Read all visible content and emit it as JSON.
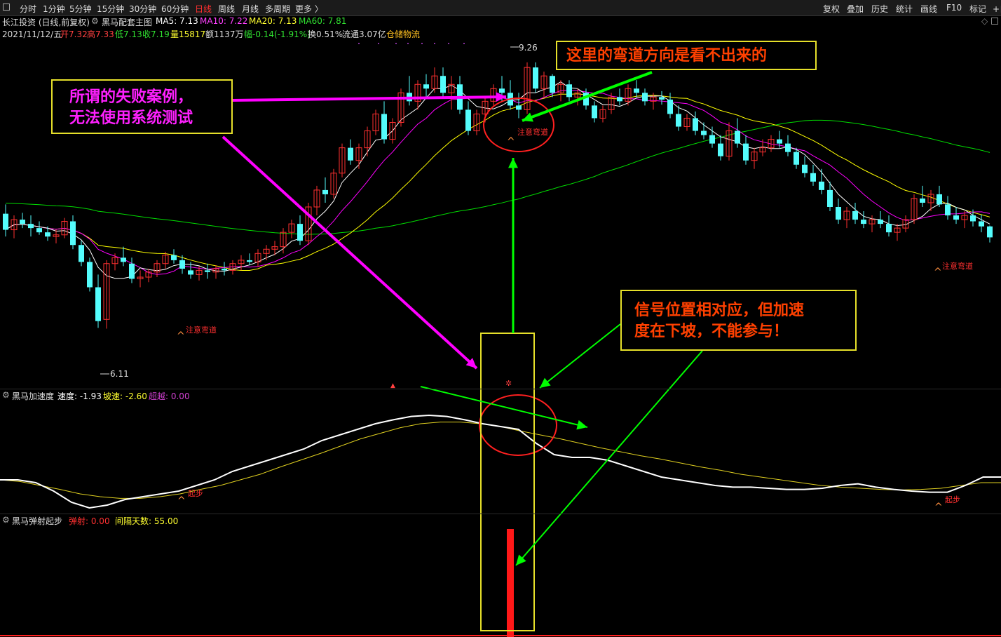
{
  "toolbar": {
    "periods": [
      "分时",
      "1分钟",
      "5分钟",
      "15分钟",
      "30分钟",
      "60分钟",
      "日线",
      "周线",
      "月线",
      "多周期",
      "更多 〉"
    ],
    "active_period": "日线",
    "right_items": [
      "复权",
      "叠加",
      "历史",
      "统计",
      "画线",
      "F10",
      "标记",
      "+自"
    ]
  },
  "header": {
    "stock": "长江投资 (日线,前复权)",
    "indicator": "黑马配套主图",
    "ma5": "MA5: 7.13",
    "ma10": "MA10: 7.22",
    "ma20": "MA20: 7.13",
    "ma60": "MA60: 7.81",
    "date": "2021/11/12/五",
    "open": "开7.32",
    "high": "高7.33",
    "low": "低7.13",
    "close": "收7.19",
    "volume": "量15817",
    "amount": "额1137万",
    "change": "幅-0.14(-1.91%)",
    "turnover": "换0.51%",
    "float": "流通3.07亿",
    "sector": "仓储物流"
  },
  "colors": {
    "up": "#ff3030",
    "down": "#54fcfc",
    "ma5": "#ffffff",
    "ma10": "#ff00ff",
    "ma20": "#ffff00",
    "ma60": "#00dd00",
    "accent": "#ff3030",
    "callout_border": "#e6e02a",
    "magenta_arrow": "#ff00ff",
    "green_arrow": "#00ff00"
  },
  "panel2": {
    "name": "黑马加速度",
    "speed": "速度: -1.93",
    "slope": "坡速: -2.60",
    "exceed": "超越: 0.00"
  },
  "panel3": {
    "name": "黑马弹射起步",
    "eject": "弹射: 0.00",
    "interval": "间隔天数: 55.00"
  },
  "annotations": {
    "callout1": [
      "所谓的失败案例，",
      "无法使用系统测试"
    ],
    "callout2": "这里的弯道方向是看不出来的",
    "callout3": [
      "信号位置相对应，但加速",
      "度在下坡，不能参与！"
    ],
    "markers": {
      "high": "9.26",
      "low": "6.11",
      "curve1": "注意弯道",
      "curve2": "注意弯道",
      "curve3": "注意弯道",
      "start1": "起步",
      "start2": "起步"
    }
  },
  "chart_data": [
    {
      "type": "candlestick",
      "title": "黑马配套主图",
      "ylim": [
        5.6,
        9.5
      ],
      "candles": [
        [
          7.47,
          7.58,
          7.2,
          7.28
        ],
        [
          7.28,
          7.45,
          7.18,
          7.4
        ],
        [
          7.4,
          7.48,
          7.3,
          7.35
        ],
        [
          7.35,
          7.45,
          7.2,
          7.3
        ],
        [
          7.3,
          7.38,
          7.22,
          7.25
        ],
        [
          7.25,
          7.32,
          7.15,
          7.2
        ],
        [
          7.2,
          7.28,
          7.12,
          7.22
        ],
        [
          7.22,
          7.42,
          7.18,
          7.38
        ],
        [
          7.38,
          7.45,
          7.05,
          7.1
        ],
        [
          7.1,
          7.15,
          6.85,
          6.9
        ],
        [
          6.9,
          6.95,
          6.55,
          6.6
        ],
        [
          6.6,
          6.75,
          6.12,
          6.2
        ],
        [
          6.22,
          6.92,
          6.11,
          6.88
        ],
        [
          6.88,
          7.0,
          6.8,
          6.95
        ],
        [
          6.95,
          7.08,
          6.85,
          6.9
        ],
        [
          6.88,
          6.95,
          6.65,
          6.7
        ],
        [
          6.7,
          6.8,
          6.6,
          6.72
        ],
        [
          6.72,
          6.82,
          6.66,
          6.78
        ],
        [
          6.78,
          6.92,
          6.72,
          6.88
        ],
        [
          6.88,
          7.02,
          6.82,
          6.98
        ],
        [
          6.98,
          7.05,
          6.88,
          6.92
        ],
        [
          6.92,
          6.98,
          6.76,
          6.82
        ],
        [
          6.8,
          6.9,
          6.7,
          6.75
        ],
        [
          6.75,
          6.85,
          6.68,
          6.8
        ],
        [
          6.8,
          6.88,
          6.7,
          6.78
        ],
        [
          6.78,
          6.86,
          6.7,
          6.82
        ],
        [
          6.82,
          6.9,
          6.74,
          6.8
        ],
        [
          6.8,
          6.92,
          6.75,
          6.88
        ],
        [
          6.88,
          6.98,
          6.8,
          6.92
        ],
        [
          6.92,
          7.0,
          6.86,
          6.9
        ],
        [
          6.9,
          7.05,
          6.84,
          7.0
        ],
        [
          7.0,
          7.1,
          6.92,
          7.05
        ],
        [
          7.05,
          7.15,
          6.98,
          7.08
        ],
        [
          7.08,
          7.3,
          7.0,
          7.25
        ],
        [
          7.25,
          7.4,
          7.18,
          7.35
        ],
        [
          7.35,
          7.45,
          7.1,
          7.15
        ],
        [
          7.15,
          7.6,
          7.1,
          7.55
        ],
        [
          7.55,
          7.8,
          7.45,
          7.75
        ],
        [
          7.75,
          7.9,
          7.6,
          7.7
        ],
        [
          7.7,
          8.0,
          7.65,
          7.95
        ],
        [
          7.95,
          8.3,
          7.9,
          8.25
        ],
        [
          8.25,
          8.35,
          8.05,
          8.1
        ],
        [
          8.1,
          8.3,
          8.0,
          8.25
        ],
        [
          8.25,
          8.5,
          8.15,
          8.45
        ],
        [
          8.45,
          8.7,
          8.4,
          8.65
        ],
        [
          8.65,
          8.8,
          8.3,
          8.35
        ],
        [
          8.35,
          8.6,
          8.3,
          8.55
        ],
        [
          8.55,
          8.95,
          8.5,
          8.9
        ],
        [
          8.9,
          9.1,
          8.75,
          8.8
        ],
        [
          8.8,
          9.05,
          8.7,
          9.0
        ],
        [
          9.0,
          9.12,
          8.85,
          8.95
        ],
        [
          8.95,
          9.2,
          8.9,
          9.1
        ],
        [
          9.1,
          9.2,
          8.85,
          8.9
        ],
        [
          8.9,
          9.1,
          8.7,
          9.0
        ],
        [
          9.0,
          9.1,
          8.65,
          8.7
        ],
        [
          8.7,
          8.8,
          8.4,
          8.45
        ],
        [
          8.45,
          8.7,
          8.4,
          8.65
        ],
        [
          8.65,
          8.85,
          8.55,
          8.8
        ],
        [
          8.8,
          9.0,
          8.75,
          8.95
        ],
        [
          8.95,
          9.1,
          8.8,
          8.9
        ],
        [
          8.9,
          9.05,
          8.7,
          8.75
        ],
        [
          8.75,
          8.9,
          8.6,
          8.7
        ],
        [
          8.7,
          9.26,
          8.65,
          9.2
        ],
        [
          9.2,
          9.26,
          8.9,
          8.95
        ],
        [
          8.95,
          9.15,
          8.85,
          9.1
        ],
        [
          9.1,
          9.12,
          8.85,
          8.9
        ],
        [
          8.9,
          9.05,
          8.8,
          9.0
        ],
        [
          9.0,
          9.05,
          8.8,
          8.85
        ],
        [
          8.85,
          8.95,
          8.75,
          8.9
        ],
        [
          8.9,
          8.95,
          8.7,
          8.75
        ],
        [
          8.75,
          8.8,
          8.55,
          8.6
        ],
        [
          8.6,
          8.75,
          8.55,
          8.7
        ],
        [
          8.7,
          8.9,
          8.65,
          8.85
        ],
        [
          8.85,
          8.95,
          8.75,
          8.8
        ],
        [
          8.8,
          9.0,
          8.75,
          8.95
        ],
        [
          8.95,
          9.05,
          8.85,
          8.9
        ],
        [
          8.9,
          8.95,
          8.75,
          8.8
        ],
        [
          8.8,
          8.9,
          8.7,
          8.85
        ],
        [
          8.85,
          8.92,
          8.76,
          8.82
        ],
        [
          8.82,
          8.9,
          8.6,
          8.65
        ],
        [
          8.65,
          8.75,
          8.45,
          8.5
        ],
        [
          8.5,
          8.65,
          8.45,
          8.6
        ],
        [
          8.6,
          8.68,
          8.4,
          8.45
        ],
        [
          8.45,
          8.55,
          8.35,
          8.4
        ],
        [
          8.4,
          8.5,
          8.25,
          8.3
        ],
        [
          8.3,
          8.4,
          8.1,
          8.15
        ],
        [
          8.15,
          8.55,
          8.1,
          8.45
        ],
        [
          8.45,
          8.6,
          8.25,
          8.3
        ],
        [
          8.3,
          8.4,
          8.05,
          8.1
        ],
        [
          8.1,
          8.25,
          8.0,
          8.2
        ],
        [
          8.2,
          8.35,
          8.15,
          8.25
        ],
        [
          8.25,
          8.4,
          8.2,
          8.35
        ],
        [
          8.35,
          8.45,
          8.25,
          8.3
        ],
        [
          8.3,
          8.4,
          8.15,
          8.2
        ],
        [
          8.2,
          8.25,
          8.0,
          8.05
        ],
        [
          8.05,
          8.15,
          7.9,
          7.95
        ],
        [
          7.95,
          8.05,
          7.8,
          7.85
        ],
        [
          7.85,
          8.0,
          7.7,
          7.75
        ],
        [
          7.75,
          7.85,
          7.5,
          7.55
        ],
        [
          7.55,
          7.65,
          7.35,
          7.4
        ],
        [
          7.4,
          7.55,
          7.3,
          7.5
        ],
        [
          7.5,
          7.6,
          7.35,
          7.4
        ],
        [
          7.4,
          7.5,
          7.3,
          7.35
        ],
        [
          7.35,
          7.45,
          7.25,
          7.4
        ],
        [
          7.4,
          7.5,
          7.3,
          7.35
        ],
        [
          7.35,
          7.45,
          7.2,
          7.25
        ],
        [
          7.25,
          7.35,
          7.15,
          7.3
        ],
        [
          7.3,
          7.45,
          7.25,
          7.4
        ],
        [
          7.4,
          7.7,
          7.35,
          7.65
        ],
        [
          7.65,
          7.8,
          7.55,
          7.6
        ],
        [
          7.6,
          7.75,
          7.5,
          7.7
        ],
        [
          7.7,
          7.8,
          7.55,
          7.58
        ],
        [
          7.58,
          7.68,
          7.4,
          7.45
        ],
        [
          7.45,
          7.55,
          7.35,
          7.4
        ],
        [
          7.4,
          7.5,
          7.3,
          7.45
        ],
        [
          7.45,
          7.52,
          7.32,
          7.38
        ],
        [
          7.38,
          7.46,
          7.25,
          7.32
        ],
        [
          7.32,
          7.33,
          7.13,
          7.19
        ]
      ],
      "series": [
        {
          "name": "MA5",
          "value": "7.13"
        },
        {
          "name": "MA10",
          "value": "7.22"
        },
        {
          "name": "MA20",
          "value": "7.13"
        },
        {
          "name": "MA60",
          "value": "7.81"
        }
      ]
    },
    {
      "type": "line",
      "title": "黑马加速度",
      "series": [
        {
          "name": "速度",
          "values": [
            0.55,
            0.55,
            0.5,
            0.35,
            0.15,
            0.05,
            0.1,
            0.2,
            0.25,
            0.3,
            0.35,
            0.45,
            0.55,
            0.7,
            0.8,
            0.9,
            1.0,
            1.1,
            1.25,
            1.35,
            1.45,
            1.55,
            1.62,
            1.68,
            1.7,
            1.68,
            1.62,
            1.55,
            1.5,
            1.45,
            1.2,
            1.0,
            0.95,
            0.95,
            0.9,
            0.8,
            0.7,
            0.6,
            0.55,
            0.5,
            0.45,
            0.42,
            0.42,
            0.4,
            0.38,
            0.38,
            0.4,
            0.45,
            0.48,
            0.42,
            0.38,
            0.35,
            0.33,
            0.33,
            0.45,
            0.6,
            0.6
          ]
        },
        {
          "name": "坡速",
          "values": [
            0.55,
            0.52,
            0.45,
            0.38,
            0.3,
            0.25,
            0.22,
            0.22,
            0.25,
            0.3,
            0.38,
            0.45,
            0.55,
            0.65,
            0.78,
            0.9,
            1.02,
            1.15,
            1.28,
            1.38,
            1.48,
            1.55,
            1.58,
            1.58,
            1.55,
            1.5,
            1.42,
            1.35,
            1.28,
            1.2,
            1.12,
            1.05,
            0.98,
            0.92,
            0.85,
            0.78,
            0.72,
            0.65,
            0.6,
            0.55,
            0.5,
            0.45,
            0.42,
            0.4,
            0.38,
            0.37,
            0.38,
            0.4,
            0.45,
            0.5,
            0.5
          ]
        }
      ],
      "ylim": [
        0,
        2
      ]
    },
    {
      "type": "bar",
      "title": "黑马弹射起步",
      "series": [
        {
          "name": "弹射",
          "values": [
            1
          ]
        }
      ],
      "ylim": [
        0,
        1.5
      ]
    }
  ]
}
